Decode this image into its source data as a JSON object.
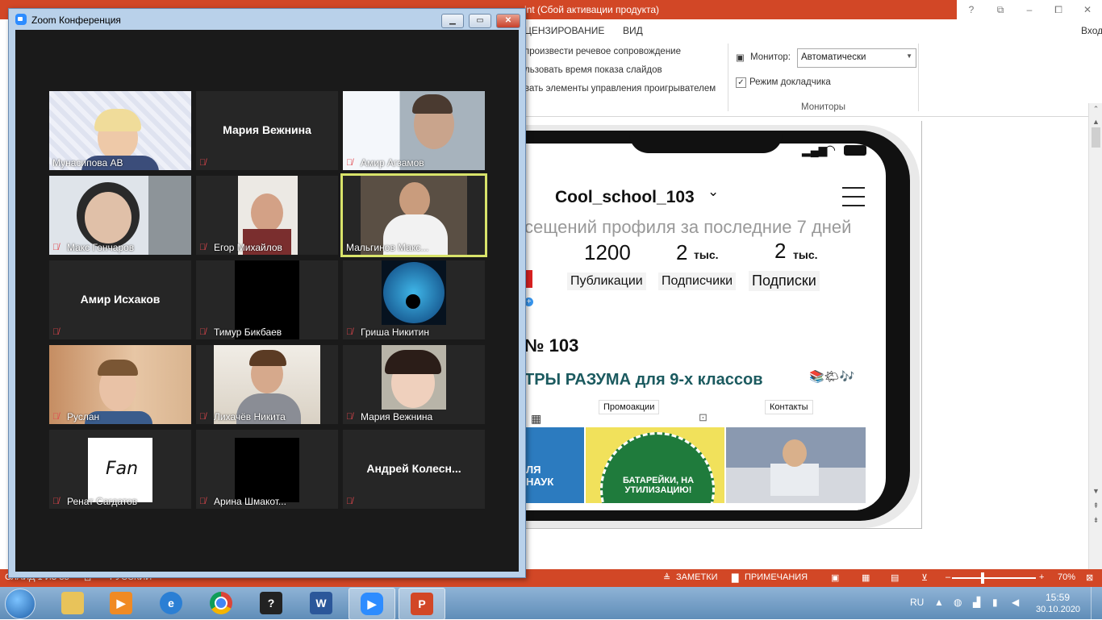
{
  "ppt": {
    "title_fragment": "int (Сбой активации продукта)",
    "window_controls": [
      "?",
      "⧉",
      "–",
      "⧠",
      "✕"
    ],
    "login": "Вход",
    "tabs": [
      "ЦЕНЗИРОВАНИЕ",
      "ВИД"
    ],
    "ribbon": {
      "opt1": "произвести речевое сопровождение",
      "opt2": "льзовать время показа слайдов",
      "opt3": "вать элементы управления проигрывателем",
      "monitor_label": "Монитор:",
      "monitor_value": "Автоматически",
      "presenter_mode": "Режим докладчика",
      "group_label": "Мониторы"
    },
    "status": {
      "slide_info": "СЛАЙД 1 ИЗ 33",
      "language": "РУССКИЙ",
      "notes": "ЗАМЕТКИ",
      "comments": "ПРИМЕЧАНИЯ",
      "zoom_minus": "–",
      "zoom_plus": "+",
      "zoom": "70%"
    }
  },
  "instagram": {
    "username": "Cool_school_103",
    "visits": "сещений профиля за последние 7 дней",
    "stats": [
      {
        "num": "1200",
        "unit": "",
        "label": "Публикации"
      },
      {
        "num": "2",
        "unit": "тыс.",
        "label": "Подписчики"
      },
      {
        "num": "2",
        "unit": "тыс.",
        "label": "Подписки"
      }
    ],
    "name": "№ 103",
    "bio": "ТРЫ РАЗУМА для 9-х классов",
    "bio_emoji": "📚🌤🎶",
    "highlights": [
      "Промоакции",
      "Контакты"
    ],
    "tile1_text": "ЛЯ НАУК",
    "tile2_text": "БАТАРЕЙКИ, НА УТИЛИЗАЦИЮ!"
  },
  "zoom": {
    "title": "Zoom Конференция",
    "participants": [
      {
        "name": "Мунасипова АВ",
        "muted": false,
        "video": "woman-blonde"
      },
      {
        "name": "Мария Вежнина",
        "muted": true,
        "video": "none"
      },
      {
        "name": "Амир Агзамов",
        "muted": true,
        "video": "boy-window"
      },
      {
        "name": "Макс Гончаров",
        "muted": true,
        "video": "boy-headphones"
      },
      {
        "name": "Егор Михайлов",
        "muted": true,
        "video": "boy-small"
      },
      {
        "name": "Мальгинов Макс...",
        "muted": false,
        "video": "boy-active",
        "active": true
      },
      {
        "name": "Амир Исхаков",
        "muted": true,
        "video": "none"
      },
      {
        "name": "Тимур Бикбаев",
        "muted": true,
        "video": "black"
      },
      {
        "name": "Гриша Никитин",
        "muted": true,
        "video": "yinyang"
      },
      {
        "name": "Руслан",
        "muted": true,
        "video": "boy-room"
      },
      {
        "name": "Лихачёв Никита",
        "muted": true,
        "video": "boy-light"
      },
      {
        "name": "Мария Вежнина",
        "muted": true,
        "video": "girl"
      },
      {
        "name": "Ренат Сагдатов",
        "muted": true,
        "video": "fan"
      },
      {
        "name": "Арина Шмакот...",
        "muted": true,
        "video": "black"
      },
      {
        "name": "Андрей  Колесн...",
        "muted": true,
        "video": "none"
      }
    ],
    "fan_text": "Fan"
  },
  "taskbar": {
    "apps": [
      "start",
      "explorer",
      "media-player",
      "internet-explorer",
      "chrome",
      "some-app",
      "word",
      "zoom",
      "powerpoint"
    ],
    "lang": "RU",
    "time": "15:59",
    "date": "30.10.2020"
  }
}
